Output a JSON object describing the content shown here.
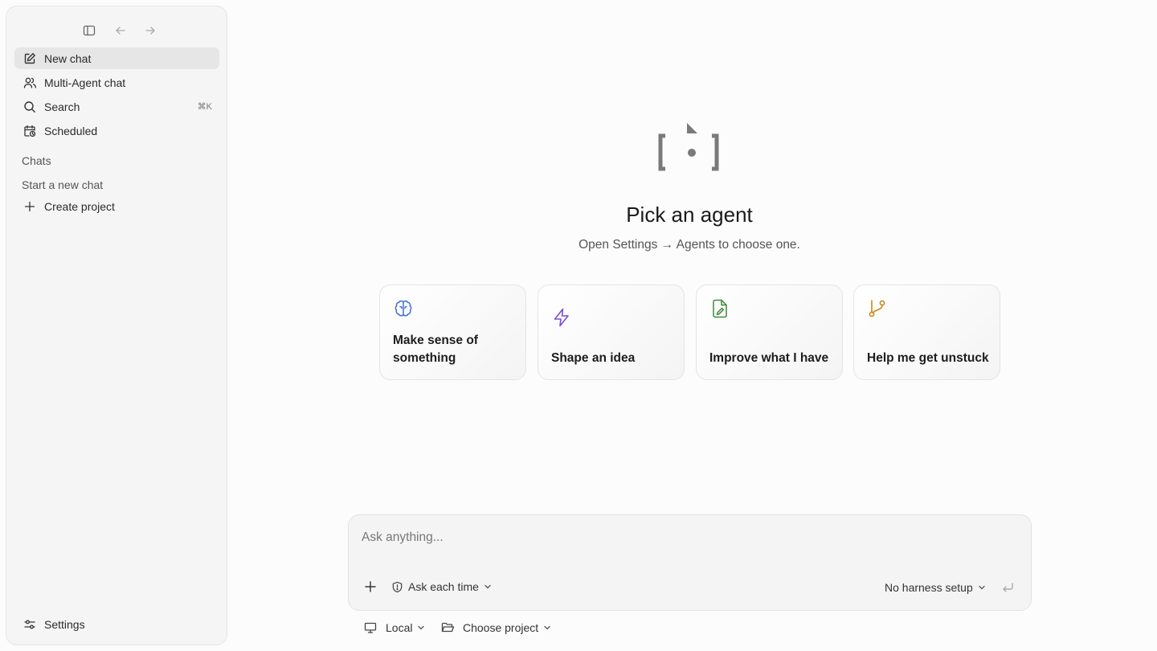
{
  "sidebar": {
    "nav": [
      {
        "label": "New chat",
        "icon": "edit-icon"
      },
      {
        "label": "Multi-Agent chat",
        "icon": "users-icon"
      },
      {
        "label": "Search",
        "icon": "search-icon",
        "shortcut": "⌘K"
      },
      {
        "label": "Scheduled",
        "icon": "calendar-clock-icon"
      }
    ],
    "section_title": "Chats",
    "empty_text": "Start a new chat",
    "create_project": "Create project",
    "settings": "Settings"
  },
  "main": {
    "headline": "Pick an agent",
    "subline": "Open Settings → Agents to choose one.",
    "cards": [
      {
        "label": "Make sense of something",
        "icon": "brain-icon",
        "color": "#3f6fd6"
      },
      {
        "label": "Shape an idea",
        "icon": "zap-icon",
        "color": "#7b4fd6"
      },
      {
        "label": "Improve what I have",
        "icon": "file-pen-icon",
        "color": "#3d8a3d"
      },
      {
        "label": "Help me get unstuck",
        "icon": "git-branch-icon",
        "color": "#c98a1a"
      }
    ]
  },
  "composer": {
    "placeholder": "Ask anything...",
    "permission": "Ask each time",
    "harness": "No harness setup"
  },
  "footer": {
    "environment": "Local",
    "project": "Choose project"
  }
}
